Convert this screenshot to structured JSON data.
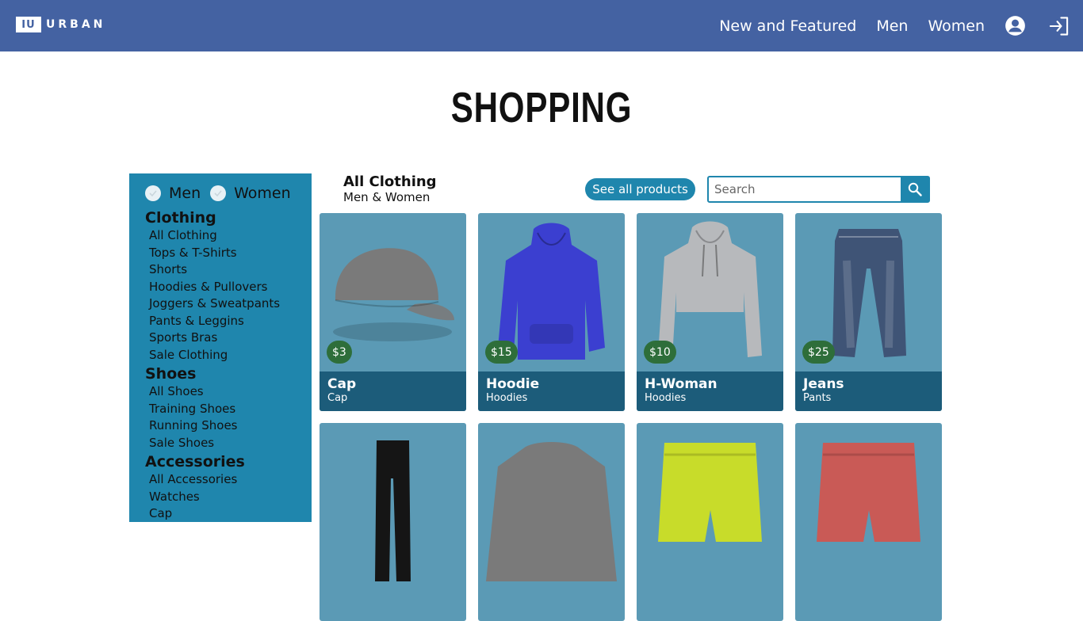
{
  "brand": {
    "mark": "IU",
    "name": "URBAN"
  },
  "nav": {
    "links": [
      "New and Featured",
      "Men",
      "Women"
    ],
    "icons": [
      "account-icon",
      "login-icon"
    ]
  },
  "page": {
    "title": "SHOPPING"
  },
  "filters": {
    "men_label": "Men",
    "women_label": "Women",
    "men_checked": true,
    "women_checked": true
  },
  "sidebar": {
    "groups": [
      {
        "heading": "Clothing",
        "items": [
          "All Clothing",
          "Tops & T-Shirts",
          "Shorts",
          "Hoodies & Pullovers",
          "Joggers & Sweatpants",
          "Pants & Leggins",
          "Sports Bras",
          "Sale Clothing"
        ]
      },
      {
        "heading": "Shoes",
        "items": [
          "All Shoes",
          "Training Shoes",
          "Running Shoes",
          "Sale Shoes"
        ]
      },
      {
        "heading": "Accessories",
        "items": [
          "All Accessories",
          "Watches",
          "Cap"
        ]
      }
    ]
  },
  "main": {
    "title": "All Clothing",
    "subtitle": "Men & Women",
    "see_all_label": "See all products",
    "search_placeholder": "Search"
  },
  "products": [
    {
      "name": "Cap",
      "category": "Cap",
      "price": "$3",
      "icon": "cap-image",
      "color": "#7a7a7a"
    },
    {
      "name": "Hoodie",
      "category": "Hoodies",
      "price": "$15",
      "icon": "hoodie-image",
      "color": "#3b3fd0"
    },
    {
      "name": "H-Woman",
      "category": "Hoodies",
      "price": "$10",
      "icon": "crop-hoodie-image",
      "color": "#b7b9bc"
    },
    {
      "name": "Jeans",
      "category": "Pants",
      "price": "$25",
      "icon": "jeans-image",
      "color": "#3f5476"
    },
    {
      "name": "",
      "category": "",
      "price": "",
      "icon": "leggings-image",
      "color": "#151515"
    },
    {
      "name": "",
      "category": "",
      "price": "",
      "icon": "sweater-image",
      "color": "#7a7a7a"
    },
    {
      "name": "",
      "category": "",
      "price": "",
      "icon": "shorts-image",
      "color": "#c8dc2a"
    },
    {
      "name": "",
      "category": "",
      "price": "",
      "icon": "shorts-image",
      "color": "#c95a56"
    }
  ],
  "colors": {
    "navbar": "#4462a2",
    "sidebar": "#1f86ad",
    "card": "#5b9ab5",
    "card_footer": "#1c5c7a",
    "price_badge": "#2e6e3a"
  }
}
